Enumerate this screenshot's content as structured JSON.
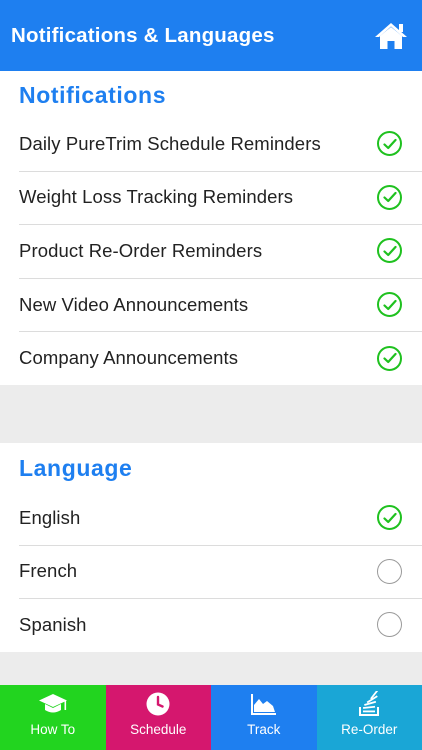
{
  "header": {
    "title": "Notifications & Languages",
    "home_icon": "home-icon"
  },
  "notifications": {
    "title": "Notifications",
    "items": [
      {
        "label": "Daily PureTrim Schedule Reminders",
        "checked": true
      },
      {
        "label": "Weight Loss Tracking Reminders",
        "checked": true
      },
      {
        "label": "Product Re-Order Reminders",
        "checked": true
      },
      {
        "label": "New Video Announcements",
        "checked": true
      },
      {
        "label": "Company Announcements",
        "checked": true
      }
    ]
  },
  "language": {
    "title": "Language",
    "items": [
      {
        "label": "English",
        "selected": true
      },
      {
        "label": "French",
        "selected": false
      },
      {
        "label": "Spanish",
        "selected": false
      }
    ]
  },
  "tabs": [
    {
      "label": "How To",
      "icon": "graduation-cap-icon",
      "color": "#22d41f"
    },
    {
      "label": "Schedule",
      "icon": "clock-icon",
      "color": "#d5176e"
    },
    {
      "label": "Track",
      "icon": "area-chart-icon",
      "color": "#1e7ff0"
    },
    {
      "label": "Re-Order",
      "icon": "stack-icon",
      "color": "#1aa6d6"
    }
  ],
  "colors": {
    "accent": "#1e7ff0",
    "check": "#1fc11f",
    "background": "#ececec"
  }
}
